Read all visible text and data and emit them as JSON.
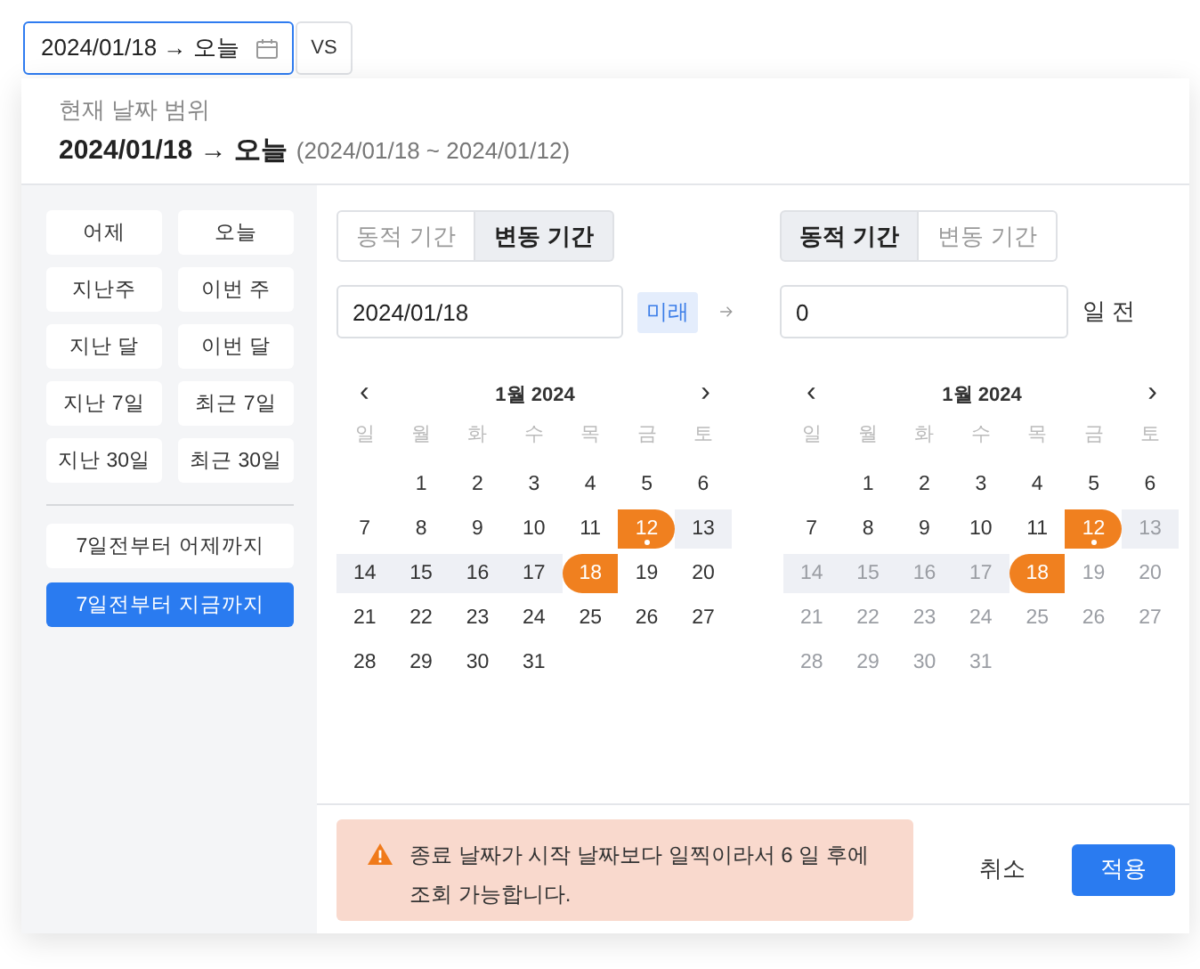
{
  "trigger": {
    "value": "2024/01/18 → 오늘",
    "focused": true
  },
  "compare_button": "VS",
  "header": {
    "caption": "현재 날짜 범위",
    "range": "2024/01/18 → 오늘",
    "range_detail": "(2024/01/18 ~ 2024/01/12)"
  },
  "presets": [
    {
      "label": "어제",
      "selected": false
    },
    {
      "label": "오늘",
      "selected": false
    },
    {
      "label": "지난주",
      "selected": false
    },
    {
      "label": "이번 주",
      "selected": false
    },
    {
      "label": "지난 달",
      "selected": false
    },
    {
      "label": "이번 달",
      "selected": false
    },
    {
      "label": "지난 7일",
      "selected": false
    },
    {
      "label": "최근 7일",
      "selected": false
    },
    {
      "label": "지난 30일",
      "selected": false
    },
    {
      "label": "최근 30일",
      "selected": false
    }
  ],
  "custom_presets": [
    {
      "label": "7일전부터 어제까지",
      "selected": false
    },
    {
      "label": "7일전부터 지금까지",
      "selected": true
    }
  ],
  "start": {
    "tabs": [
      {
        "label": "동적 기간",
        "selected": false
      },
      {
        "label": "변동 기간",
        "selected": true
      }
    ],
    "input": {
      "value": "2024/01/18"
    },
    "badge": "미래",
    "calendar": {
      "prev": "‹",
      "title": "1월 2024",
      "next": "›",
      "weekdays": [
        "일",
        "월",
        "화",
        "수",
        "목",
        "금",
        "토"
      ],
      "weeks": [
        [
          {
            "label": "1",
            "range_start": false,
            "range_end": false,
            "in_range": false,
            "today": false,
            "disabled": false
          },
          {
            "label": "2",
            "range_start": false,
            "range_end": false,
            "in_range": false,
            "today": false,
            "disabled": false
          },
          {
            "label": "3",
            "range_start": false,
            "range_end": false,
            "in_range": false,
            "today": false,
            "disabled": false
          },
          {
            "label": "4",
            "range_start": false,
            "range_end": false,
            "in_range": false,
            "today": false,
            "disabled": false
          },
          {
            "label": "5",
            "range_start": false,
            "range_end": false,
            "in_range": false,
            "today": false,
            "disabled": false
          },
          {
            "label": "6",
            "range_start": false,
            "range_end": false,
            "in_range": false,
            "today": false,
            "disabled": false
          }
        ],
        [
          {
            "label": "7",
            "range_start": false,
            "range_end": false,
            "in_range": false,
            "today": false,
            "disabled": false
          },
          {
            "label": "8",
            "range_start": false,
            "range_end": false,
            "in_range": false,
            "today": false,
            "disabled": false
          },
          {
            "label": "9",
            "range_start": false,
            "range_end": false,
            "in_range": false,
            "today": false,
            "disabled": false
          },
          {
            "label": "10",
            "range_start": false,
            "range_end": false,
            "in_range": false,
            "today": false,
            "disabled": false
          },
          {
            "label": "11",
            "range_start": false,
            "range_end": false,
            "in_range": false,
            "today": false,
            "disabled": false
          },
          {
            "label": "12",
            "range_start": false,
            "range_end": true,
            "in_range": false,
            "today": true,
            "disabled": false
          },
          {
            "label": "13",
            "range_start": false,
            "range_end": false,
            "in_range": true,
            "today": false,
            "disabled": false
          }
        ],
        [
          {
            "label": "14",
            "range_start": false,
            "range_end": false,
            "in_range": true,
            "today": false,
            "disabled": false
          },
          {
            "label": "15",
            "range_start": false,
            "range_end": false,
            "in_range": true,
            "today": false,
            "disabled": false
          },
          {
            "label": "16",
            "range_start": false,
            "range_end": false,
            "in_range": true,
            "today": false,
            "disabled": false
          },
          {
            "label": "17",
            "range_start": false,
            "range_end": false,
            "in_range": true,
            "today": false,
            "disabled": false
          },
          {
            "label": "18",
            "range_start": true,
            "range_end": false,
            "in_range": false,
            "today": false,
            "disabled": false
          },
          {
            "label": "19",
            "range_start": false,
            "range_end": false,
            "in_range": false,
            "today": false,
            "disabled": false
          },
          {
            "label": "20",
            "range_start": false,
            "range_end": false,
            "in_range": false,
            "today": false,
            "disabled": false
          }
        ],
        [
          {
            "label": "21",
            "range_start": false,
            "range_end": false,
            "in_range": false,
            "today": false,
            "disabled": false
          },
          {
            "label": "22",
            "range_start": false,
            "range_end": false,
            "in_range": false,
            "today": false,
            "disabled": false
          },
          {
            "label": "23",
            "range_start": false,
            "range_end": false,
            "in_range": false,
            "today": false,
            "disabled": false
          },
          {
            "label": "24",
            "range_start": false,
            "range_end": false,
            "in_range": false,
            "today": false,
            "disabled": false
          },
          {
            "label": "25",
            "range_start": false,
            "range_end": false,
            "in_range": false,
            "today": false,
            "disabled": false
          },
          {
            "label": "26",
            "range_start": false,
            "range_end": false,
            "in_range": false,
            "today": false,
            "disabled": false
          },
          {
            "label": "27",
            "range_start": false,
            "range_end": false,
            "in_range": false,
            "today": false,
            "disabled": false
          }
        ],
        [
          {
            "label": "28",
            "range_start": false,
            "range_end": false,
            "in_range": false,
            "today": false,
            "disabled": false
          },
          {
            "label": "29",
            "range_start": false,
            "range_end": false,
            "in_range": false,
            "today": false,
            "disabled": false
          },
          {
            "label": "30",
            "range_start": false,
            "range_end": false,
            "in_range": false,
            "today": false,
            "disabled": false
          },
          {
            "label": "31",
            "range_start": false,
            "range_end": false,
            "in_range": false,
            "today": false,
            "disabled": false
          }
        ]
      ]
    }
  },
  "end": {
    "tabs": [
      {
        "label": "동적 기간",
        "selected": true
      },
      {
        "label": "변동 기간",
        "selected": false
      }
    ],
    "input": {
      "value": "0"
    },
    "unit": "일 전",
    "calendar": {
      "prev": "‹",
      "title": "1월 2024",
      "next": "›",
      "weekdays": [
        "일",
        "월",
        "화",
        "수",
        "목",
        "금",
        "토"
      ],
      "weeks": [
        [
          {
            "label": "1",
            "range_start": false,
            "range_end": false,
            "in_range": false,
            "today": false,
            "disabled": false
          },
          {
            "label": "2",
            "range_start": false,
            "range_end": false,
            "in_range": false,
            "today": false,
            "disabled": false
          },
          {
            "label": "3",
            "range_start": false,
            "range_end": false,
            "in_range": false,
            "today": false,
            "disabled": false
          },
          {
            "label": "4",
            "range_start": false,
            "range_end": false,
            "in_range": false,
            "today": false,
            "disabled": false
          },
          {
            "label": "5",
            "range_start": false,
            "range_end": false,
            "in_range": false,
            "today": false,
            "disabled": false
          },
          {
            "label": "6",
            "range_start": false,
            "range_end": false,
            "in_range": false,
            "today": false,
            "disabled": false
          }
        ],
        [
          {
            "label": "7",
            "range_start": false,
            "range_end": false,
            "in_range": false,
            "today": false,
            "disabled": false
          },
          {
            "label": "8",
            "range_start": false,
            "range_end": false,
            "in_range": false,
            "today": false,
            "disabled": false
          },
          {
            "label": "9",
            "range_start": false,
            "range_end": false,
            "in_range": false,
            "today": false,
            "disabled": false
          },
          {
            "label": "10",
            "range_start": false,
            "range_end": false,
            "in_range": false,
            "today": false,
            "disabled": false
          },
          {
            "label": "11",
            "range_start": false,
            "range_end": false,
            "in_range": false,
            "today": false,
            "disabled": false
          },
          {
            "label": "12",
            "range_start": false,
            "range_end": true,
            "in_range": false,
            "today": true,
            "disabled": false
          },
          {
            "label": "13",
            "range_start": false,
            "range_end": false,
            "in_range": true,
            "today": false,
            "disabled": true
          }
        ],
        [
          {
            "label": "14",
            "range_start": false,
            "range_end": false,
            "in_range": true,
            "today": false,
            "disabled": true
          },
          {
            "label": "15",
            "range_start": false,
            "range_end": false,
            "in_range": true,
            "today": false,
            "disabled": true
          },
          {
            "label": "16",
            "range_start": false,
            "range_end": false,
            "in_range": true,
            "today": false,
            "disabled": true
          },
          {
            "label": "17",
            "range_start": false,
            "range_end": false,
            "in_range": true,
            "today": false,
            "disabled": true
          },
          {
            "label": "18",
            "range_start": true,
            "range_end": false,
            "in_range": false,
            "today": false,
            "disabled": false
          },
          {
            "label": "19",
            "range_start": false,
            "range_end": false,
            "in_range": false,
            "today": false,
            "disabled": true
          },
          {
            "label": "20",
            "range_start": false,
            "range_end": false,
            "in_range": false,
            "today": false,
            "disabled": true
          }
        ],
        [
          {
            "label": "21",
            "range_start": false,
            "range_end": false,
            "in_range": false,
            "today": false,
            "disabled": true
          },
          {
            "label": "22",
            "range_start": false,
            "range_end": false,
            "in_range": false,
            "today": false,
            "disabled": true
          },
          {
            "label": "23",
            "range_start": false,
            "range_end": false,
            "in_range": false,
            "today": false,
            "disabled": true
          },
          {
            "label": "24",
            "range_start": false,
            "range_end": false,
            "in_range": false,
            "today": false,
            "disabled": true
          },
          {
            "label": "25",
            "range_start": false,
            "range_end": false,
            "in_range": false,
            "today": false,
            "disabled": true
          },
          {
            "label": "26",
            "range_start": false,
            "range_end": false,
            "in_range": false,
            "today": false,
            "disabled": true
          },
          {
            "label": "27",
            "range_start": false,
            "range_end": false,
            "in_range": false,
            "today": false,
            "disabled": true
          }
        ],
        [
          {
            "label": "28",
            "range_start": false,
            "range_end": false,
            "in_range": false,
            "today": false,
            "disabled": true
          },
          {
            "label": "29",
            "range_start": false,
            "range_end": false,
            "in_range": false,
            "today": false,
            "disabled": true
          },
          {
            "label": "30",
            "range_start": false,
            "range_end": false,
            "in_range": false,
            "today": false,
            "disabled": true
          },
          {
            "label": "31",
            "range_start": false,
            "range_end": false,
            "in_range": false,
            "today": false,
            "disabled": true
          }
        ]
      ]
    }
  },
  "warning": "종료 날짜가 시작 날짜보다 일찍이라서 6 일 후에 조회 가능합니다.",
  "actions": [
    {
      "label": "취소",
      "kind": "text"
    },
    {
      "label": "적용",
      "kind": "primary"
    }
  ]
}
